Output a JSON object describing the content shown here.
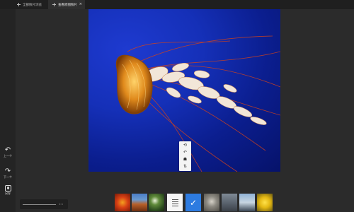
{
  "tabs": [
    {
      "label": "全部照片浏览",
      "icon": "plus-icon"
    },
    {
      "label": "查看原图照片",
      "icon": "plus-icon",
      "close": "×",
      "active": true
    }
  ],
  "sidebar": {
    "prev": {
      "glyph": "↶",
      "label": "上一个"
    },
    "next": {
      "glyph": "↷",
      "label": "下一个"
    },
    "save": {
      "label": "另存"
    }
  },
  "zoom": {
    "value": "1:1"
  },
  "context_menu": {
    "items": [
      {
        "glyph": "⟲",
        "icon": "rotate-icon"
      },
      {
        "glyph": "↶",
        "icon": "undo-icon"
      },
      {
        "glyph": "☗",
        "icon": "crop-icon"
      },
      {
        "glyph": "⇅",
        "icon": "flip-icon"
      }
    ]
  },
  "filmstrip": {
    "thumbnails": [
      {
        "kind": "photo",
        "subject": "red flower"
      },
      {
        "kind": "photo",
        "subject": "desert landscape"
      },
      {
        "kind": "photo",
        "subject": "green leaves"
      },
      {
        "kind": "doc",
        "subject": "document"
      },
      {
        "kind": "selected",
        "glyph": "✓"
      },
      {
        "kind": "photo",
        "subject": "koala"
      },
      {
        "kind": "photo",
        "subject": "lighthouse"
      },
      {
        "kind": "photo",
        "subject": "penguins"
      },
      {
        "kind": "photo",
        "subject": "yellow tulips"
      }
    ],
    "selected_index": 4
  },
  "colors": {
    "background": "#2b2b2b",
    "accent": "#2d7be0",
    "image_blue": "#1530b8"
  }
}
